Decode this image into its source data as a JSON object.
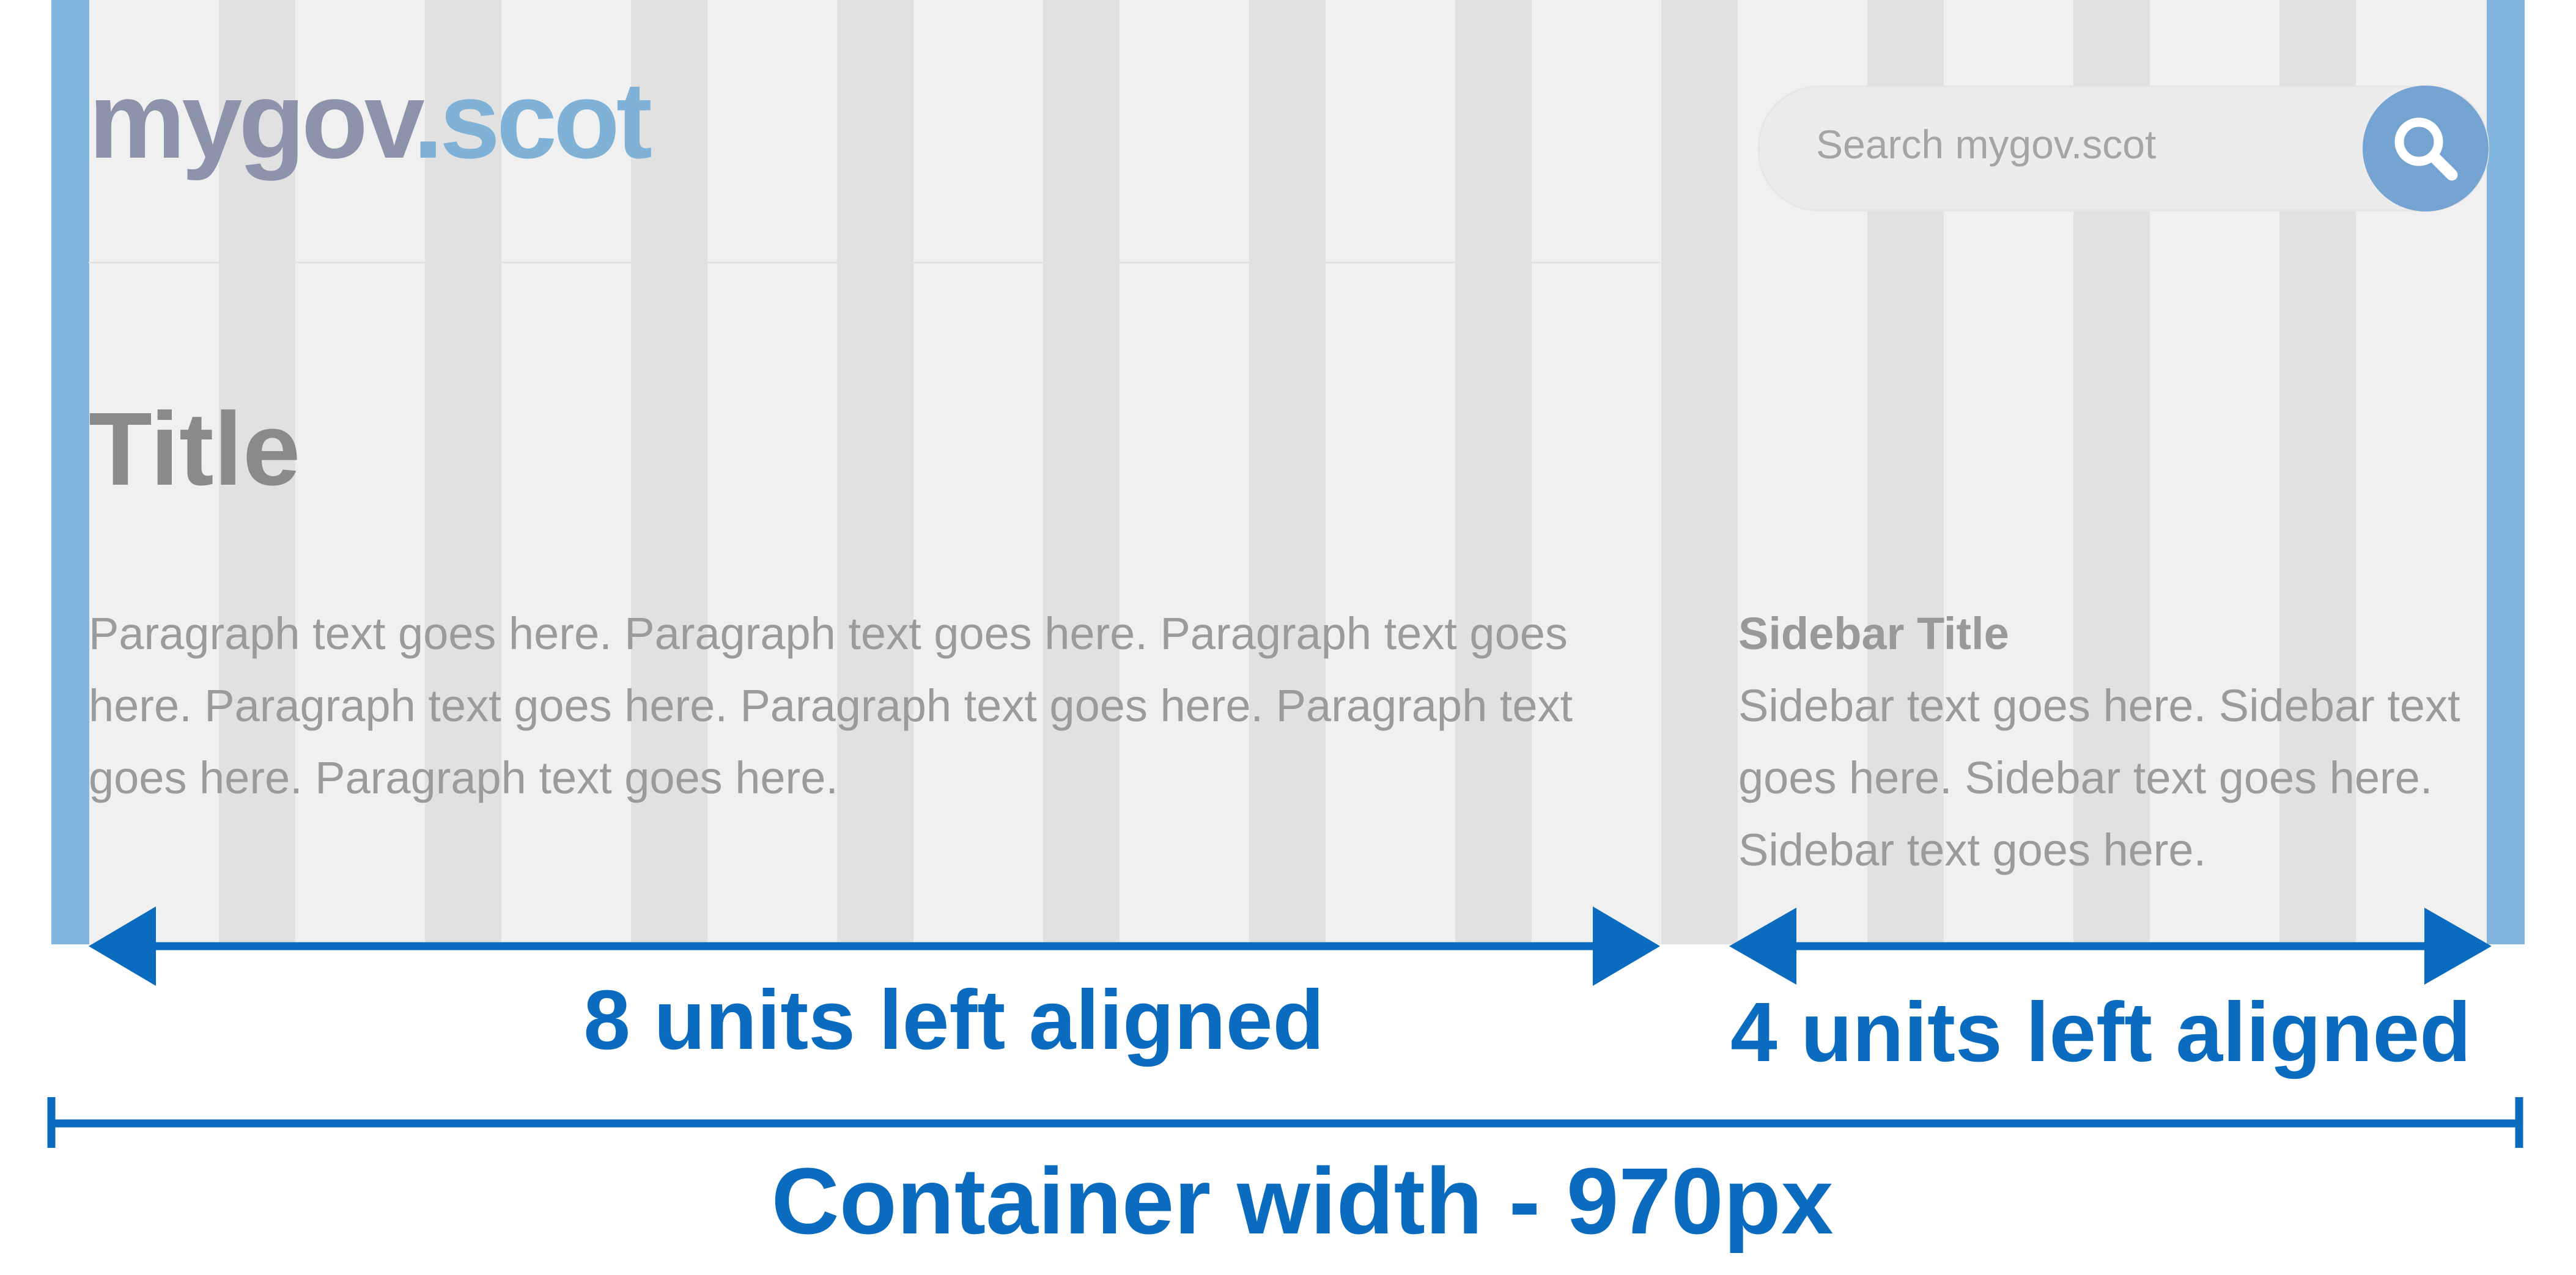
{
  "logo": {
    "part1": "mygov",
    "part2": ".scot"
  },
  "search": {
    "placeholder": "Search mygov.scot"
  },
  "page_title": "Title",
  "paragraph": "Paragraph text goes here. Paragraph text goes here. Paragraph text goes here. Paragraph text goes here. Paragraph text goes here. Paragraph text goes here. Paragraph text goes here.",
  "sidebar": {
    "title": "Sidebar Title",
    "text": "Sidebar text goes here. Sidebar text goes here. Sidebar text goes here. Sidebar text goes here."
  },
  "annotations": {
    "main_span": "8 units left aligned",
    "sidebar_span": "4 units left aligned",
    "container": "Container width - 970px"
  },
  "colors": {
    "accent": "#0b6cbf",
    "edge_bar": "#82b6de",
    "grid_column": "#e1e1e1",
    "background": "#f0f0f0"
  }
}
